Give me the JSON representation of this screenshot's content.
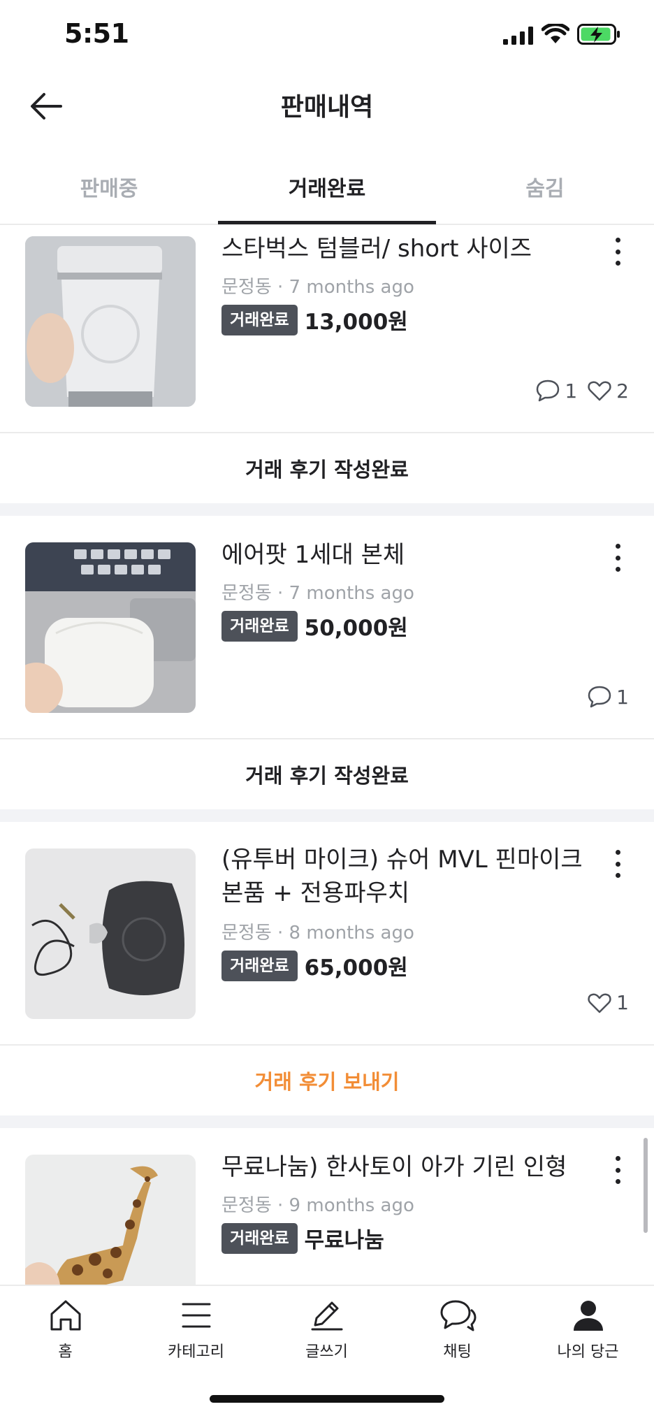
{
  "status_bar": {
    "time": "5:51"
  },
  "header": {
    "title": "판매내역"
  },
  "tabs": [
    {
      "label": "판매중",
      "active": false
    },
    {
      "label": "거래완료",
      "active": true
    },
    {
      "label": "숨김",
      "active": false
    }
  ],
  "items": [
    {
      "title": "스타벅스 텀블러/ short 사이즈",
      "meta": "문정동 · 7 months ago",
      "badge": "거래완료",
      "price": "13,000원",
      "chat_count": "1",
      "like_count": "2",
      "review_label": "거래 후기 작성완료"
    },
    {
      "title": "에어팟 1세대 본체",
      "meta": "문정동 · 7 months ago",
      "badge": "거래완료",
      "price": "50,000원",
      "chat_count": "1",
      "review_label": "거래 후기 작성완료"
    },
    {
      "title": "(유투버 마이크) 슈어 MVL 핀마이크 본품 + 전용파우치",
      "meta": "문정동 · 8 months ago",
      "badge": "거래완료",
      "price": "65,000원",
      "like_count": "1",
      "review_label": "거래 후기 보내기"
    },
    {
      "title": "무료나눔) 한사토이 아가 기린 인형",
      "meta": "문정동 · 9 months ago",
      "badge": "거래완료",
      "price": "무료나눔"
    }
  ],
  "bottom_nav": [
    {
      "label": "홈",
      "icon": "home-icon"
    },
    {
      "label": "카테고리",
      "icon": "menu-icon"
    },
    {
      "label": "글쓰기",
      "icon": "pencil-icon"
    },
    {
      "label": "채팅",
      "icon": "chat-icon"
    },
    {
      "label": "나의 당근",
      "icon": "user-icon"
    }
  ],
  "colors": {
    "accent_orange": "#f28d36",
    "badge_bg": "#4d5159",
    "battery_green": "#4cd964"
  }
}
